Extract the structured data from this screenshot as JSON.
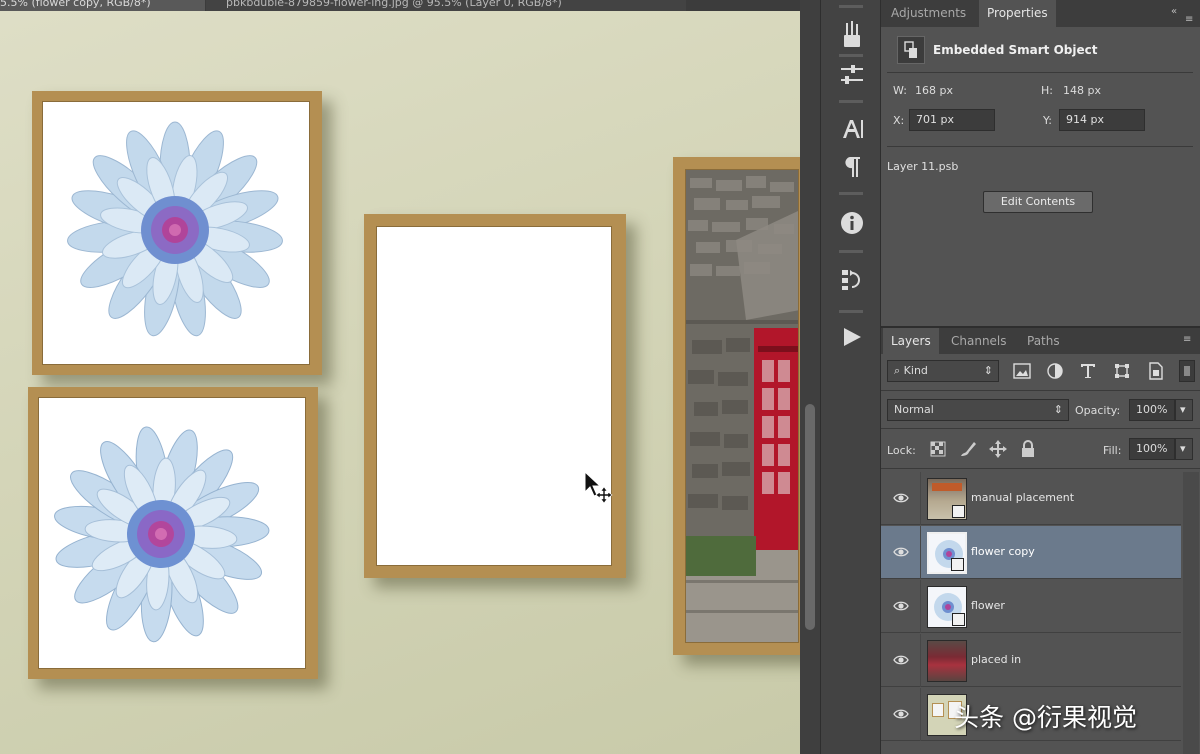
{
  "document_tabs": [
    {
      "label": "5.5% (flower copy, RGB/8*)"
    },
    {
      "label": "pbkbduble-879859-flower-ing.jpg @ 95.5% (Layer 0, RGB/8*)"
    }
  ],
  "canvas": {
    "wall_color": "#d6d7bb",
    "frame_color": "#b48f52",
    "frames": [
      {
        "name": "flower-frame-top",
        "content": "flower"
      },
      {
        "name": "flower-frame-bottom",
        "content": "flower"
      },
      {
        "name": "empty-frame",
        "content": "blank"
      },
      {
        "name": "phone-booth-frame",
        "content": "phone booth photo"
      }
    ]
  },
  "dock_icons": [
    "brush-presets-icon",
    "adjust-sliders-icon",
    "character-icon",
    "paragraph-icon",
    "info-icon",
    "history-icon",
    "play-action-icon"
  ],
  "properties": {
    "tabs": [
      {
        "label": "Adjustments"
      },
      {
        "label": "Properties"
      }
    ],
    "type_label": "Embedded Smart Object",
    "w_label": "W:",
    "w_value": "168 px",
    "h_label": "H:",
    "h_value": "148 px",
    "x_label": "X:",
    "x_value": "701 px",
    "y_label": "Y:",
    "y_value": "914 px",
    "file": "Layer 11.psb",
    "edit_button": "Edit Contents"
  },
  "layers_panel": {
    "tabs": [
      {
        "label": "Layers"
      },
      {
        "label": "Channels"
      },
      {
        "label": "Paths"
      }
    ],
    "filter_kind": "Kind",
    "blend_mode": "Normal",
    "opacity_label": "Opacity:",
    "opacity_value": "100%",
    "lock_label": "Lock:",
    "fill_label": "Fill:",
    "fill_value": "100%",
    "layers": [
      {
        "name": "manual placement",
        "selected": false
      },
      {
        "name": "flower copy",
        "selected": true
      },
      {
        "name": "flower",
        "selected": false
      },
      {
        "name": "placed in",
        "selected": false
      },
      {
        "name": "",
        "selected": false
      }
    ]
  },
  "watermark": "头条 @衍果视觉"
}
